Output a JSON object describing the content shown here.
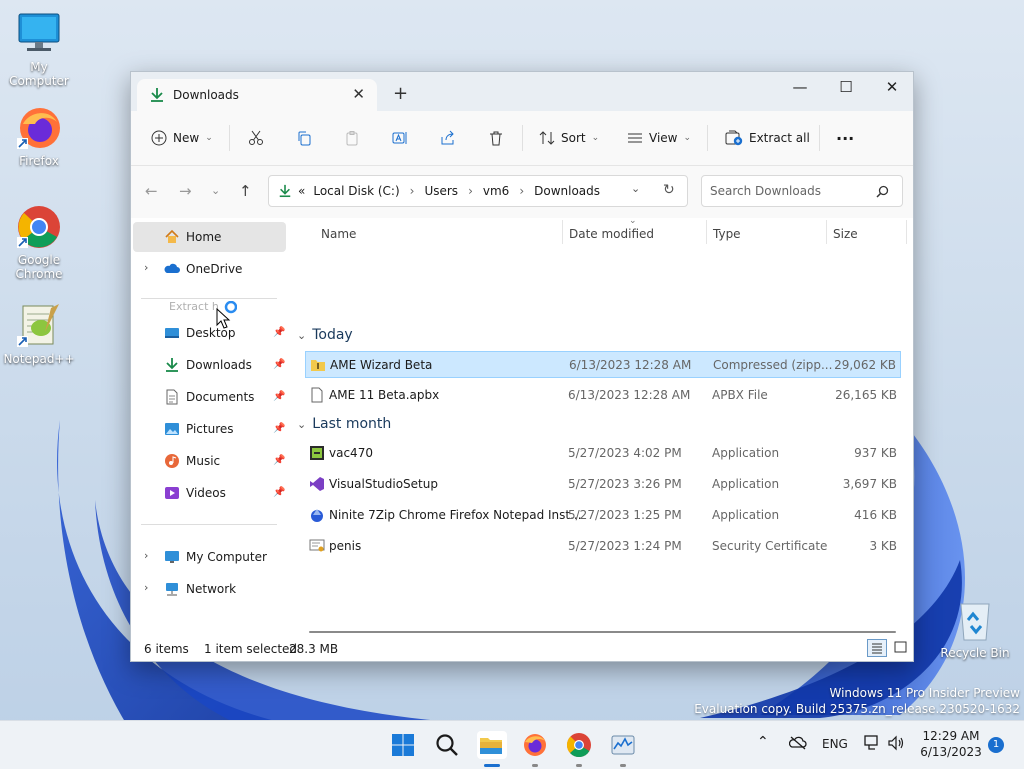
{
  "desktop": {
    "icons": [
      {
        "label": "My Computer",
        "icon": "monitor-icon"
      },
      {
        "label": "Firefox",
        "icon": "firefox-icon"
      },
      {
        "label": "Google Chrome",
        "icon": "chrome-icon"
      },
      {
        "label": "Notepad++",
        "icon": "notepadpp-icon"
      },
      {
        "label": "Recycle Bin",
        "icon": "recycle-bin-icon"
      }
    ],
    "watermark_line1": "Windows 11 Pro Insider Preview",
    "watermark_line2": "Evaluation copy. Build 25375.zn_release.230520-1632"
  },
  "window": {
    "tab_title": "Downloads",
    "new_tab": "+",
    "controls": {
      "minimize": "—",
      "maximize": "☐",
      "close": "✕"
    }
  },
  "toolbar": {
    "new_label": "New",
    "sort_label": "Sort",
    "view_label": "View",
    "extract_all_label": "Extract all",
    "more_label": "···"
  },
  "address": {
    "overflow": "«",
    "crumbs": [
      "Local Disk (C:)",
      "Users",
      "vm6",
      "Downloads"
    ],
    "separator": "›",
    "search_placeholder": "Search Downloads"
  },
  "nav": {
    "home": "Home",
    "onedrive": "OneDrive",
    "drag_ghost": "Extract h",
    "pinned": [
      {
        "label": "Desktop",
        "icon": "desktop-folder-icon"
      },
      {
        "label": "Downloads",
        "icon": "downloads-folder-icon"
      },
      {
        "label": "Documents",
        "icon": "documents-folder-icon"
      },
      {
        "label": "Pictures",
        "icon": "pictures-folder-icon"
      },
      {
        "label": "Music",
        "icon": "music-folder-icon"
      },
      {
        "label": "Videos",
        "icon": "videos-folder-icon"
      }
    ],
    "my_computer": "My Computer",
    "network": "Network"
  },
  "list": {
    "columns": {
      "name": "Name",
      "date": "Date modified",
      "type": "Type",
      "size": "Size"
    },
    "groups": [
      {
        "label": "Today",
        "files": [
          {
            "name": "AME Wizard Beta",
            "date": "6/13/2023 12:28 AM",
            "type": "Compressed (zipp...",
            "size": "29,062 KB",
            "icon": "zip-folder-icon",
            "selected": true
          },
          {
            "name": "AME 11 Beta.apbx",
            "date": "6/13/2023 12:28 AM",
            "type": "APBX File",
            "size": "26,165 KB",
            "icon": "generic-file-icon",
            "selected": false
          }
        ]
      },
      {
        "label": "Last month",
        "files": [
          {
            "name": "vac470",
            "date": "5/27/2023 4:02 PM",
            "type": "Application",
            "size": "937 KB",
            "icon": "installer-icon",
            "selected": false
          },
          {
            "name": "VisualStudioSetup",
            "date": "5/27/2023 3:26 PM",
            "type": "Application",
            "size": "3,697 KB",
            "icon": "visual-studio-icon",
            "selected": false
          },
          {
            "name": "Ninite 7Zip Chrome Firefox Notepad Inst...",
            "date": "5/27/2023 1:25 PM",
            "type": "Application",
            "size": "416 KB",
            "icon": "ninite-icon",
            "selected": false
          },
          {
            "name": "penis",
            "date": "5/27/2023 1:24 PM",
            "type": "Security Certificate",
            "size": "3 KB",
            "icon": "certificate-icon",
            "selected": false
          }
        ]
      }
    ]
  },
  "status": {
    "items": "6 items",
    "selected": "1 item selected",
    "size": "28.3 MB"
  },
  "taskbar": {
    "lang": "ENG",
    "time": "12:29 AM",
    "date": "6/13/2023",
    "notifications": "1"
  }
}
